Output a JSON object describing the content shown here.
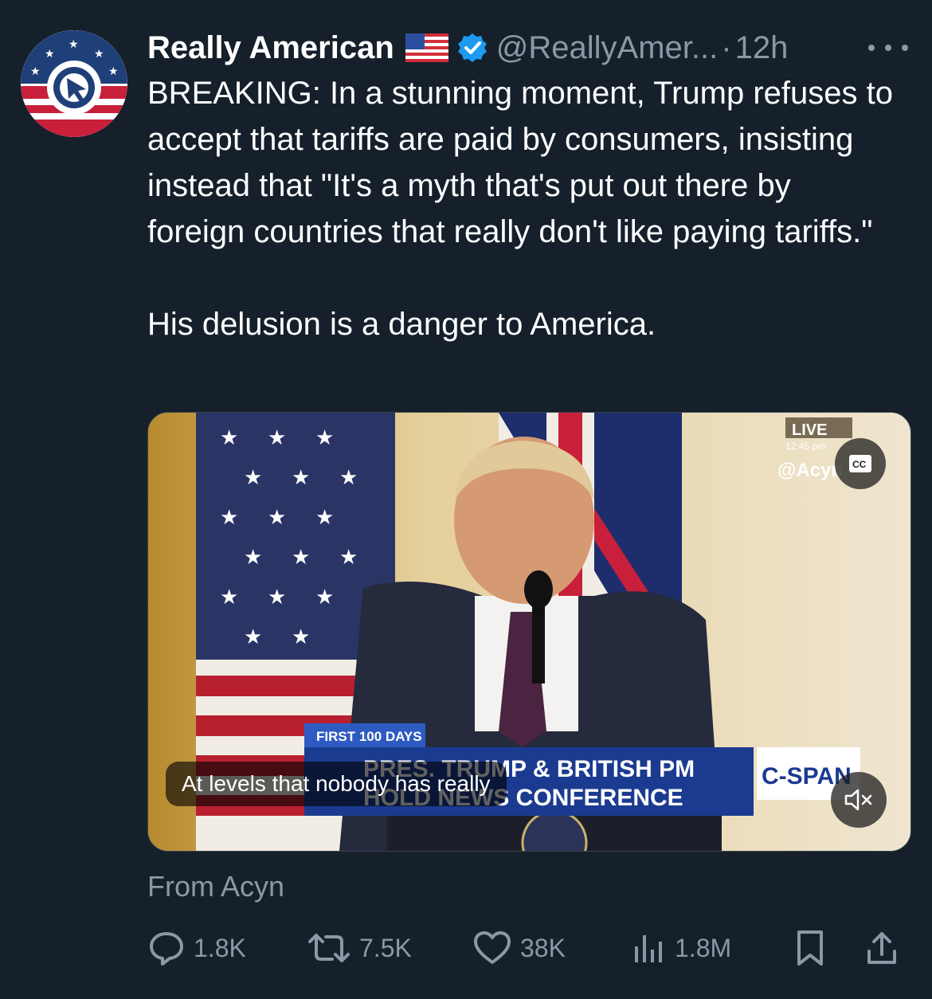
{
  "author": {
    "display_name": "Really American",
    "flag_emoji": "🇺🇸",
    "verified": true,
    "handle": "@ReallyAmer...",
    "separator": "·",
    "time": "12h"
  },
  "tweet": {
    "paragraph_1": "BREAKING: In a stunning moment, Trump refuses to accept that tariffs are paid by consumers, insisting instead that \"It's a myth that's put out there by foreign countries that really don't like paying tariffs.\"",
    "paragraph_2": "His delusion is a danger to America."
  },
  "video": {
    "caption": "At levels that nobody has really",
    "chyron_tag": "FIRST 100 DAYS",
    "chyron_line_1": "PRES. TRUMP & BRITISH PM",
    "chyron_line_2": "HOLD NEWS CONFERENCE",
    "network": "C-SPAN",
    "live_label": "LIVE",
    "live_time": "12:45 pm",
    "watermark": "@Acyn",
    "cc_label": "CC"
  },
  "attribution": "From Acyn",
  "actions": {
    "replies": "1.8K",
    "reposts": "7.5K",
    "likes": "38K",
    "views": "1.8M"
  },
  "colors": {
    "background": "#15202b",
    "secondary_text": "#8b98a5",
    "verified_blue": "#1d9bf0"
  },
  "icons": [
    "more-icon",
    "verified-icon",
    "flag-icon",
    "reply-icon",
    "repost-icon",
    "like-icon",
    "views-icon",
    "bookmark-icon",
    "share-icon",
    "cc-icon",
    "mute-icon"
  ]
}
